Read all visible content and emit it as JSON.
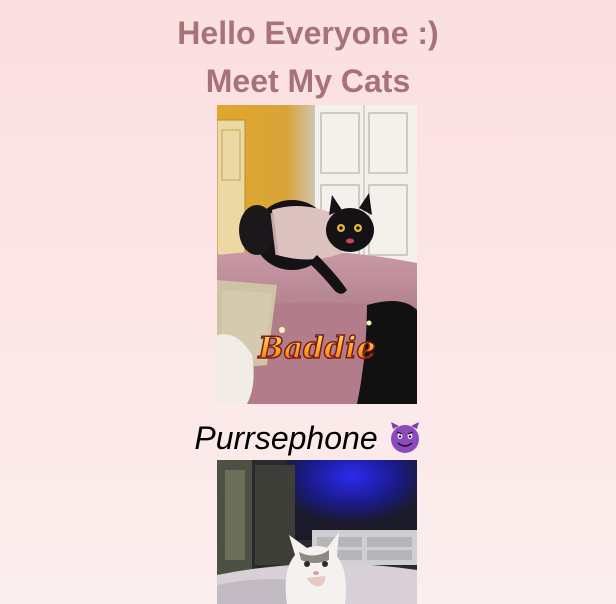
{
  "header": {
    "greeting": "Hello Everyone :)",
    "subtitle": "Meet My Cats"
  },
  "cats": [
    {
      "photo_sticker_text": "Baddie",
      "name": "Purrsephone",
      "emoji_icon": "smiling-devil-emoji-icon"
    },
    {
      "photo_sticker_text": ""
    }
  ],
  "colors": {
    "heading": "#a8727a",
    "background_top": "#fbdfe0",
    "background_bottom": "#fbeeee",
    "caption": "#000000"
  }
}
